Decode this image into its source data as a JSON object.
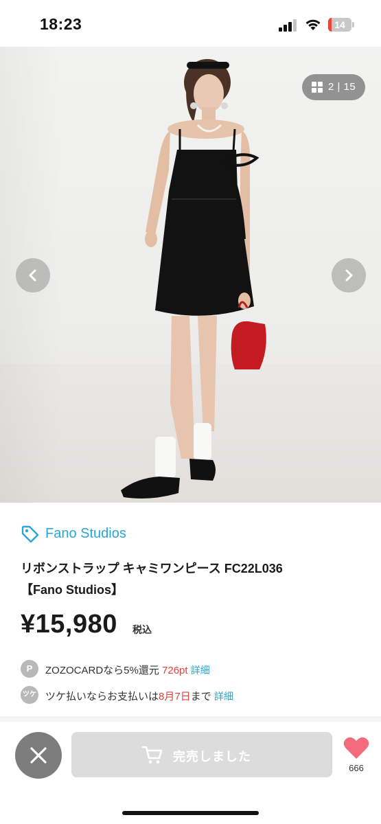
{
  "status_bar": {
    "time": "18:23",
    "battery_level": "14",
    "battery_fraction": 0.14,
    "battery_color": "#e8443a"
  },
  "gallery": {
    "counter": "2 | 15",
    "prev_icon": "chevron-left-icon",
    "next_icon": "chevron-right-icon"
  },
  "product": {
    "brand": "Fano Studios",
    "title_line1": "リボンストラップ キャミワンピース FC22L036",
    "title_line2": "【Fano Studios】",
    "price": "¥15,980",
    "tax_label": "税込"
  },
  "promos": {
    "zozocard": {
      "badge": "P",
      "text": "ZOZOCARDなら5%還元 ",
      "points": "726pt",
      "link": "詳細"
    },
    "tsuke": {
      "badge": "ツケ",
      "text_before": "ツケ払いならお支払いは",
      "date": "8月7日",
      "text_after": "まで ",
      "link": "詳細"
    }
  },
  "actions": {
    "close_icon": "close-icon",
    "soldout_label": "完売しました",
    "favorite_count": "666"
  },
  "colors": {
    "accent": "#2aa5d8",
    "highlight_red": "#e5403a",
    "heart": "#f56b7e",
    "disabled_button": "#dcdcdc"
  }
}
